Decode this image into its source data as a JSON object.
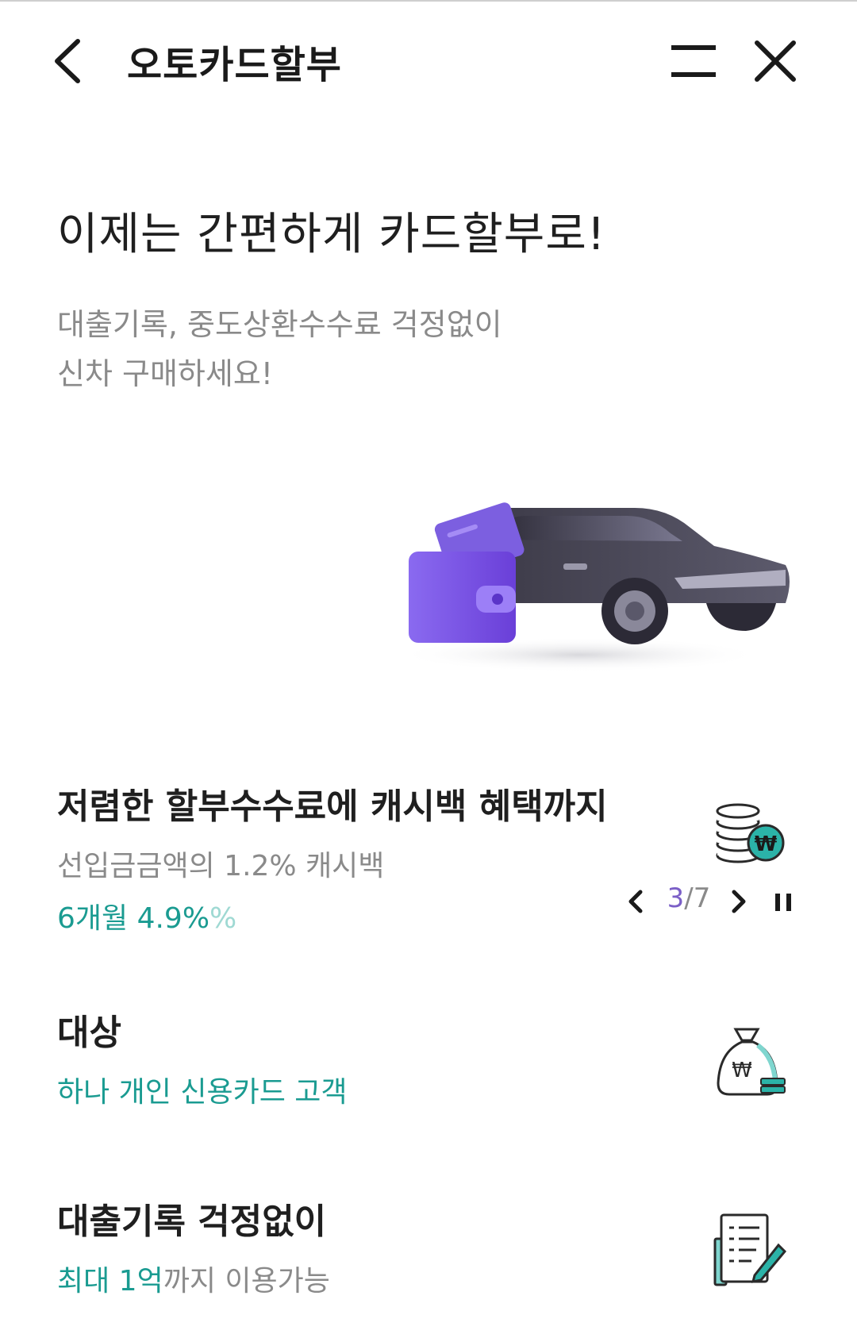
{
  "header": {
    "title": "오토카드할부"
  },
  "hero": {
    "headline": "이제는 간편하게 카드할부로!",
    "sub_line1": "대출기록, 중도상환수수료 걱정없이",
    "sub_line2": "신차 구매하세요!"
  },
  "features": [
    {
      "title": "저렴한 할부수수료에 캐시백 혜택까지",
      "desc": "선입금금액의 1.2% 캐시백",
      "highlight": "6개월 4.9%",
      "highlight_ghost": "%",
      "icon": "coin-stack-cashback-icon"
    },
    {
      "title": "대상",
      "desc_highlight": "하나 개인 신용카드 고객",
      "icon": "money-bag-icon"
    },
    {
      "title": "대출기록 걱정없이",
      "desc_highlight": "최대 1억",
      "desc_rest": "까지 이용가능",
      "icon": "document-pen-icon"
    }
  ],
  "carousel": {
    "current": "3",
    "separator": "/",
    "total": "7"
  },
  "colors": {
    "accent_teal": "#1a9b91",
    "accent_purple": "#7b5fc7",
    "text_gray": "#8a8a8a"
  }
}
